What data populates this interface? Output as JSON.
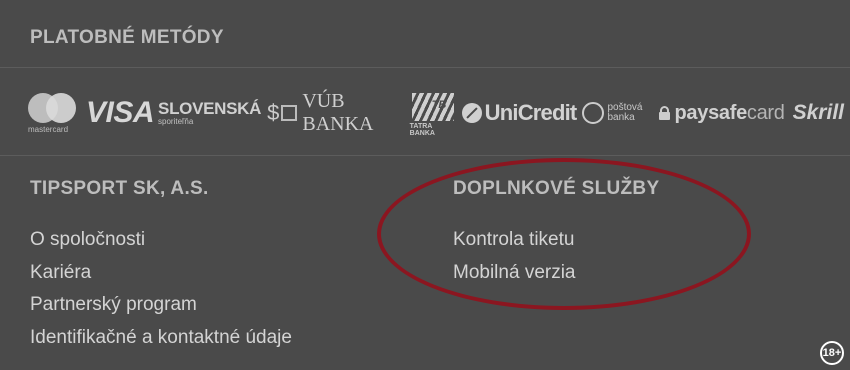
{
  "payment": {
    "title": "PLATOBNÉ METÓDY",
    "logos": {
      "mastercard": "mastercard",
      "visa": "VISA",
      "slovenska_main": "SLOVENSKÁ",
      "slovenska_sub": "sporiteľňa",
      "vub": "VÚB BANKA",
      "tatra_short": "TB",
      "tatra": "TATRA BANKA",
      "unicredit": "UniCredit",
      "postova_1": "poštová",
      "postova_2": "banka",
      "paysafe_bold": "paysafe",
      "paysafe_light": "card",
      "skrill": "Skrill"
    }
  },
  "company": {
    "title": "TIPSPORT SK, A.S.",
    "links": [
      "O spoločnosti",
      "Kariéra",
      "Partnerský program",
      "Identifikačné a kontaktné údaje"
    ]
  },
  "services": {
    "title": "DOPLNKOVÉ SLUŽBY",
    "links": [
      "Kontrola tiketu",
      "Mobilná verzia"
    ]
  },
  "age_badge": "18+",
  "colors": {
    "background": "#4a4a4a",
    "highlight": "#8b1620",
    "text": "#d4d4d4"
  }
}
